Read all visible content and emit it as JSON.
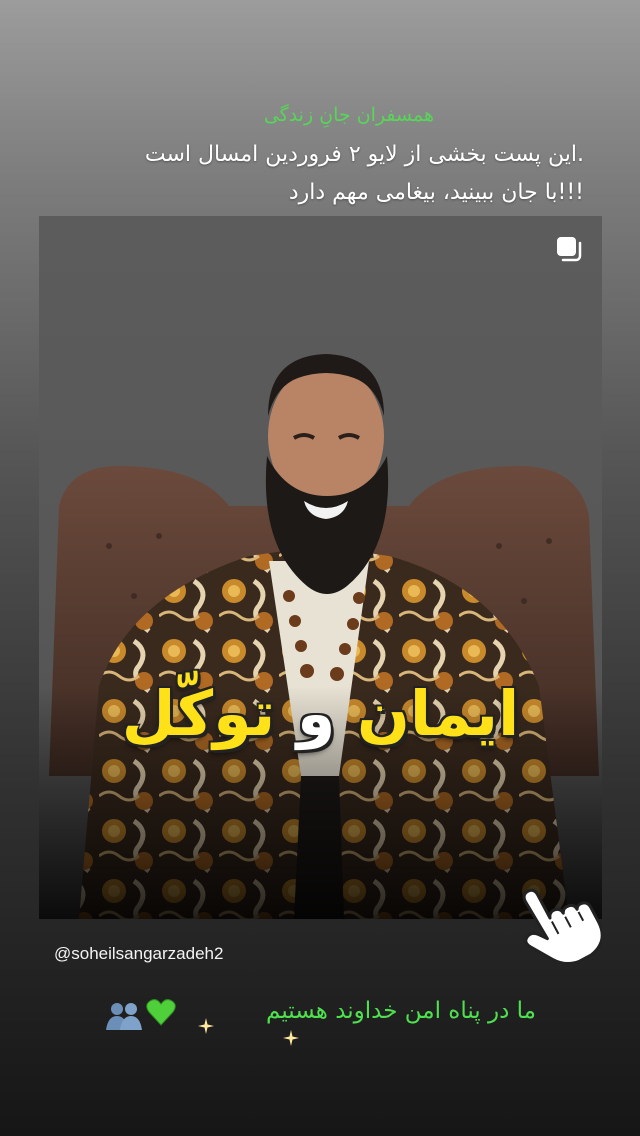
{
  "header": {
    "greeting": "همسفران جانِ زندگی",
    "caption_line1": "این پست بخشی از لایو ۲ فروردین امسال است.",
    "caption_line2": "با جان ببینید، بیغامی مهم دارد!!!"
  },
  "post": {
    "overlay_title_part1": "ایمان",
    "overlay_title_part2": "و",
    "overlay_title_part3": "توکّل",
    "multi_icon": "carousel-icon"
  },
  "mention": {
    "username": "@soheilsangarzadeh2"
  },
  "footer": {
    "text": "ما در پناه امن خداوند هستیم",
    "emoji": [
      "green-heart",
      "people"
    ]
  },
  "colors": {
    "greeting": "#57d657",
    "footer": "#4ee04e",
    "title_yellow": "#ffe11a"
  }
}
